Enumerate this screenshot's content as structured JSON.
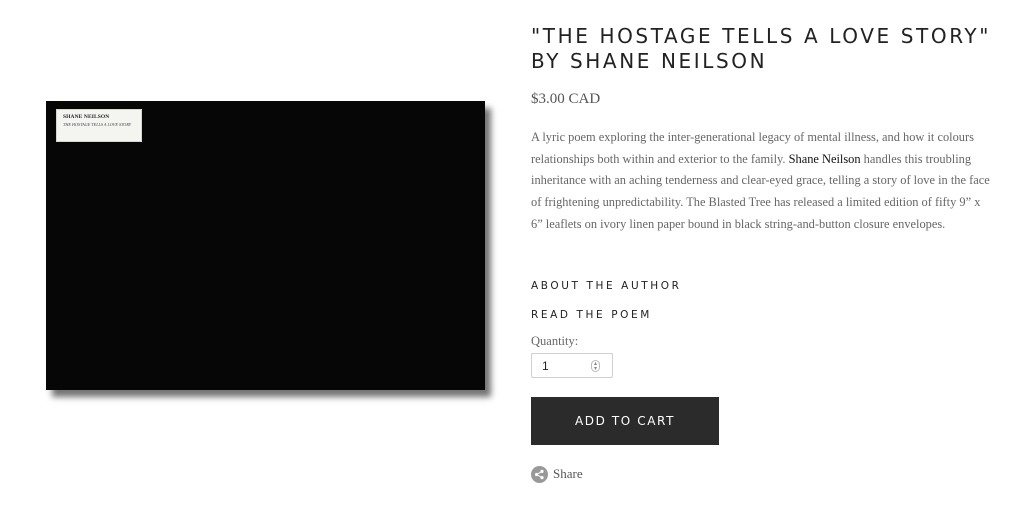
{
  "product": {
    "title": "\"THE HOSTAGE TELLS A LOVE STORY\" BY SHANE NEILSON",
    "price": "$3.00 CAD",
    "image_label": {
      "author": "SHANE NEILSON",
      "subtitle": "THE HOSTAGE TELLS A LOVE STORY"
    },
    "description": {
      "part1": "A lyric poem exploring the inter-generational legacy of mental illness, and how it colours relationships both within and exterior to the family. ",
      "author_link": "Shane Neilson",
      "part2": " handles this troubling inheritance with an aching tenderness and clear-eyed grace, telling a story of love in the face of frightening unpredictability. The Blasted Tree has released a limited edition of fifty 9” x 6” leaflets on ivory linen paper bound in black string-and-button closure envelopes."
    }
  },
  "links": {
    "about_author": "ABOUT THE AUTHOR",
    "read_poem": "READ THE POEM"
  },
  "quantity": {
    "label": "Quantity:",
    "value": "1"
  },
  "cart": {
    "button_label": "ADD TO CART"
  },
  "share": {
    "label": "Share",
    "icon": "share-icon"
  },
  "colors": {
    "button_bg": "#2b2b2b",
    "image_bg": "#060606"
  }
}
